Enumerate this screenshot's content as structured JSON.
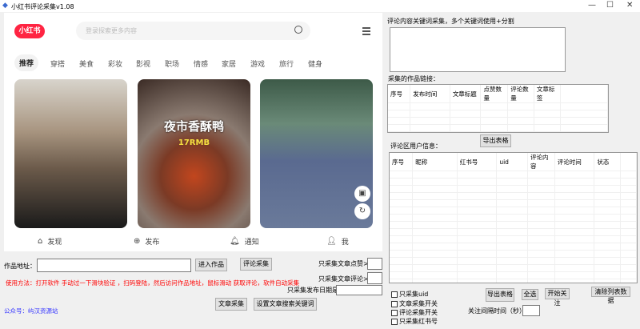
{
  "window": {
    "title": "小红书评论采集v1.08",
    "min": "—",
    "max": "☐",
    "close": "✕"
  },
  "browser": {
    "logo": "小红书",
    "search_placeholder": "登录探索更多内容",
    "tabs": [
      "推荐",
      "穿搭",
      "美食",
      "彩妆",
      "影视",
      "职场",
      "情感",
      "家居",
      "游戏",
      "旅行",
      "健身"
    ],
    "card2_title": "夜市香酥鸭",
    "card2_price": "17RMB",
    "nav": [
      {
        "icon": "home-icon",
        "label": "发现"
      },
      {
        "icon": "plus-icon",
        "label": "发布"
      },
      {
        "icon": "bell-icon",
        "label": "通知"
      },
      {
        "icon": "user-icon",
        "label": "我"
      }
    ]
  },
  "form": {
    "url_label": "作品地址：",
    "url_value": "",
    "enter_btn": "进入作品",
    "comment_btn": "评论采集",
    "likes_label": "只采集文章点赞>",
    "comments_label": "只采集文章评论>",
    "date_label": "只采集发布日期是：",
    "usage": "使用方法：打开软件 手动过一下滑块验证  ，扫码登陆，然后访问作品地址，鼠标滑动 获取评论，软件自动采集",
    "article_btn": "文章采集",
    "keyword_btn": "设置文章搜索关键词",
    "wechat": "公众号：屿汉资源站"
  },
  "right": {
    "kw_label": "评论内容关键词采集，多个关键词使用+分割",
    "kw_value": "",
    "works_label": "采集的作品链接：",
    "works_cols": [
      "序号",
      "发布时间",
      "文章标题",
      "点赞数量",
      "评论数量",
      "文章标签"
    ],
    "export_btn": "导出表格",
    "users_label": "评论区用户信息：",
    "users_cols": [
      "序号",
      "昵称",
      "红书号",
      "uid",
      "评论内容",
      "评论时间",
      "状态"
    ],
    "checkboxes": [
      "只采集uid",
      "文章采集开关",
      "评论采集开关",
      "只采集红书号"
    ],
    "export_btn2": "导出表格",
    "select_all": "全选",
    "follow_btn": "开始关注",
    "clear_btn": "清除列表数据",
    "interval_label": "关注间隔时间（秒）："
  }
}
